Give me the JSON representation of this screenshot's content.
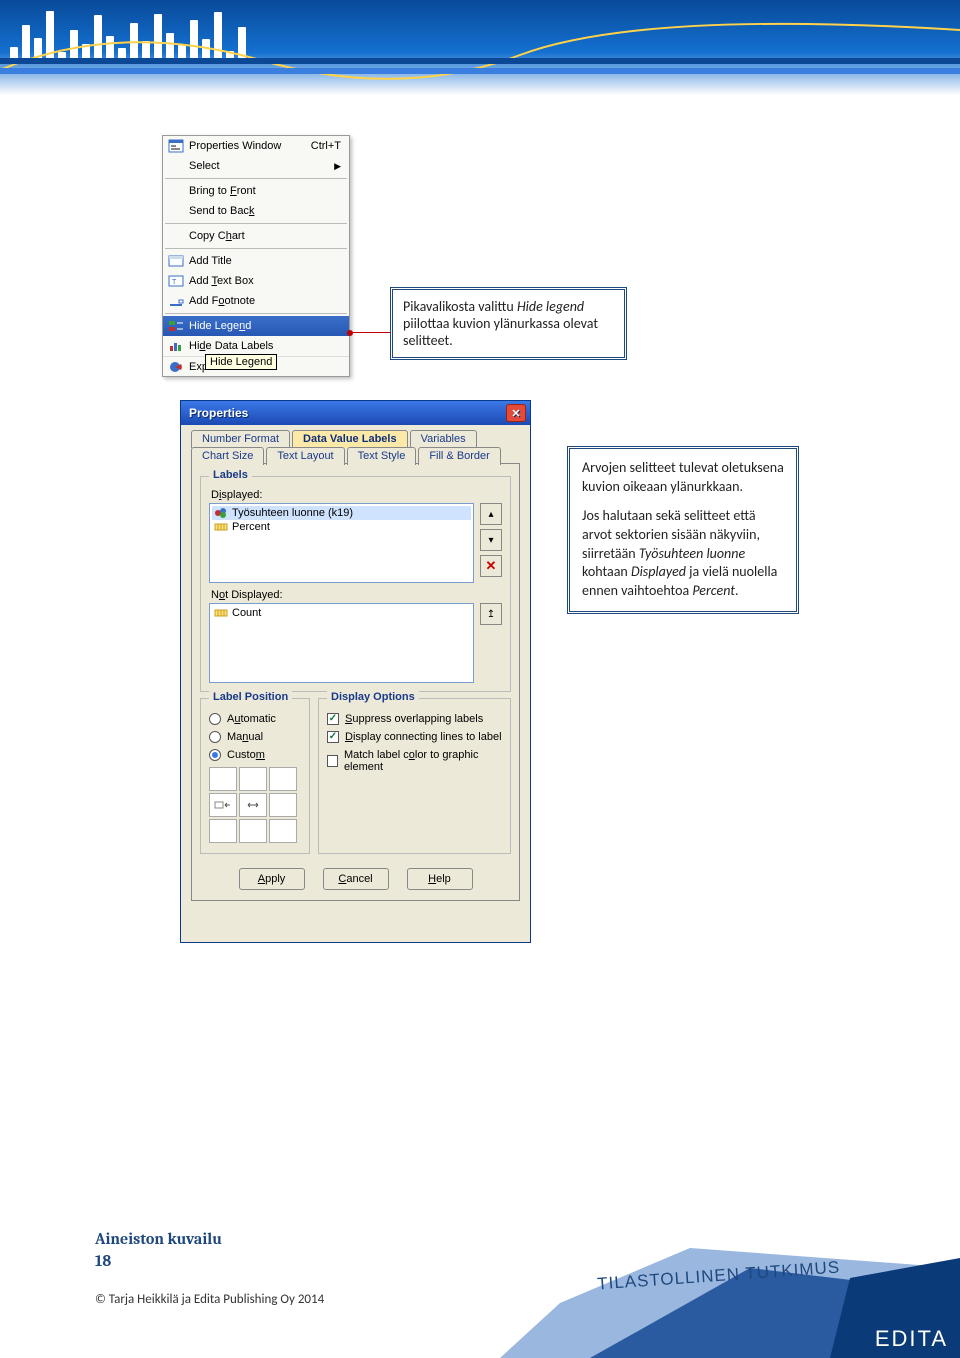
{
  "context_menu": {
    "items": [
      {
        "label": "Properties Window",
        "shortcut": "Ctrl+T",
        "icon": "properties-icon"
      },
      {
        "label": "Select",
        "submenu": true
      },
      {
        "label": "Bring to Front",
        "underline_idx": 9
      },
      {
        "label": "Send to Back",
        "underline_idx": 11
      },
      {
        "label": "Copy Chart",
        "underline_idx": 7
      },
      {
        "label": "Add Title",
        "icon": "title-icon"
      },
      {
        "label": "Add Text Box",
        "icon": "textbox-icon",
        "underline_idx": 4
      },
      {
        "label": "Add Footnote",
        "icon": "footnote-icon",
        "underline_idx": 5
      },
      {
        "label": "Hide Legend",
        "icon": "legend-icon",
        "selected": true,
        "underline_idx": 9
      },
      {
        "label": "Hide Data Labels",
        "icon": "datalabels-icon",
        "underline_idx": 3
      },
      {
        "label": "Explode Slice",
        "icon": "explode-icon"
      }
    ],
    "tooltip": "Hide Legend"
  },
  "callout1": {
    "text_before_italic": "Pikavalikosta valittu ",
    "italic": "Hide legend",
    "text_after_italic": " piilottaa kuvion ylänurkassa olevat selitteet."
  },
  "callout2": {
    "p1": "Arvojen selitteet tulevat oletuksena kuvion oikeaan ylänurkkaan.",
    "p2_a": "Jos halutaan sekä selitteet että arvot sektorien sisään näkyviin, siirretään ",
    "p2_i1": "Työsuhteen luonne",
    "p2_b": " kohtaan ",
    "p2_i2": "Displayed",
    "p2_c": " ja vielä nuolella ennen vaihtoehtoa ",
    "p2_i3": "Percent",
    "p2_d": "."
  },
  "dialog": {
    "title": "Properties",
    "tabs_row1": [
      "Number Format",
      "Data Value Labels",
      "Variables"
    ],
    "tabs_row1_active_index": 1,
    "tabs_row2": [
      "Chart Size",
      "Text Layout",
      "Text Style",
      "Fill & Border"
    ],
    "labels_group_title": "Labels",
    "displayed_label": "Displayed:",
    "not_displayed_label": "Not Displayed:",
    "displayed_items": [
      "Työsuhteen luonne (k19)",
      "Percent"
    ],
    "not_displayed_items": [
      "Count"
    ],
    "label_position": {
      "title": "Label Position",
      "options": [
        "Automatic",
        "Manual",
        "Custom"
      ],
      "selected_index": 2
    },
    "display_options": {
      "title": "Display Options",
      "options": [
        {
          "label": "Suppress overlapping labels",
          "checked": true
        },
        {
          "label": "Display connecting lines to label",
          "checked": true
        },
        {
          "label": "Match label color to graphic element",
          "checked": false
        }
      ]
    },
    "buttons": {
      "apply": "Apply",
      "cancel": "Cancel",
      "help": "Help"
    }
  },
  "footer": {
    "section": "Aineiston kuvailu",
    "page": "18",
    "copyright": "© Tarja Heikkilä ja Edita Publishing Oy 2014",
    "banner_text": "TILASTOLLINEN TUTKIMUS",
    "brand": "EDITA"
  }
}
